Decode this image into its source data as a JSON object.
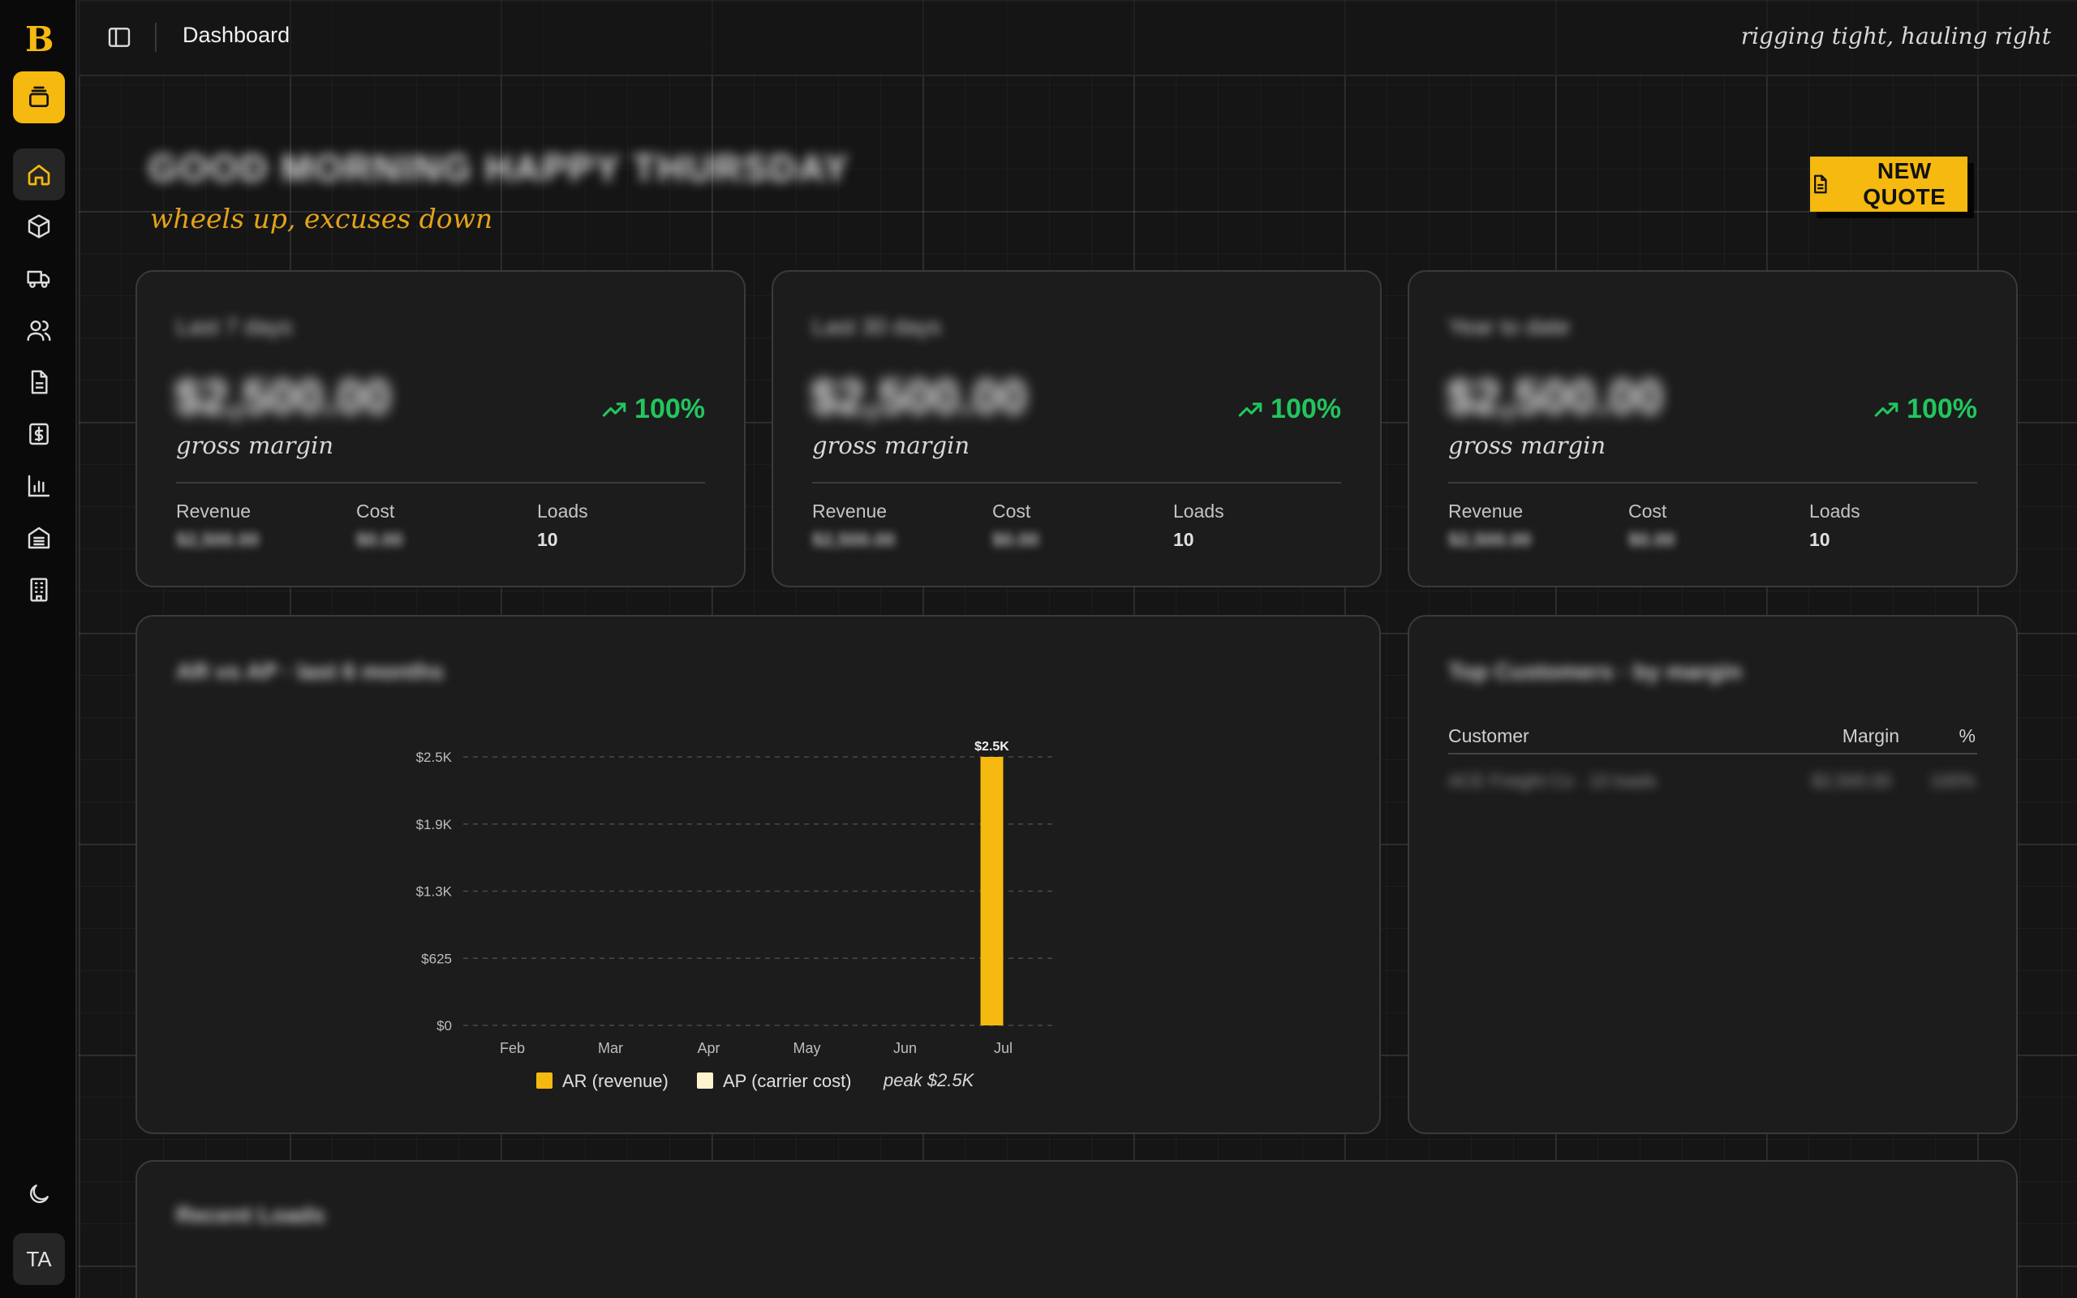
{
  "brand": {
    "logo_letter": "B",
    "accent": "#f5b90f"
  },
  "sidebar": {
    "items": [
      {
        "name": "queue",
        "icon": "stack-icon"
      },
      {
        "name": "home",
        "icon": "home-icon"
      },
      {
        "name": "loads",
        "icon": "package-icon"
      },
      {
        "name": "carriers",
        "icon": "truck-icon"
      },
      {
        "name": "customers",
        "icon": "users-icon"
      },
      {
        "name": "quotes",
        "icon": "document-icon"
      },
      {
        "name": "billing",
        "icon": "dollar-doc-icon"
      },
      {
        "name": "reports",
        "icon": "bar-chart-icon"
      },
      {
        "name": "ledger",
        "icon": "ledger-icon"
      },
      {
        "name": "companies",
        "icon": "building-icon"
      }
    ],
    "theme_icon": "moon-icon",
    "avatar_initials": "TA"
  },
  "topbar": {
    "breadcrumb": "Dashboard",
    "motto": "rigging tight, hauling right"
  },
  "header": {
    "greeting": "GOOD MORNING HAPPY THURSDAY",
    "subtitle": "wheels up, excuses down",
    "new_quote_label": "NEW QUOTE"
  },
  "kpis": [
    {
      "label": "Last 7 days",
      "amount": "$2,500.00",
      "trend": "100%",
      "caption": "gross margin",
      "revenue_label": "Revenue",
      "revenue": "$2,500.00",
      "cost_label": "Cost",
      "cost": "$0.00",
      "loads_label": "Loads",
      "loads": "10"
    },
    {
      "label": "Last 30 days",
      "amount": "$2,500.00",
      "trend": "100%",
      "caption": "gross margin",
      "revenue_label": "Revenue",
      "revenue": "$2,500.00",
      "cost_label": "Cost",
      "cost": "$0.00",
      "loads_label": "Loads",
      "loads": "10"
    },
    {
      "label": "Year to date",
      "amount": "$2,500.00",
      "trend": "100%",
      "caption": "gross margin",
      "revenue_label": "Revenue",
      "revenue": "$2,500.00",
      "cost_label": "Cost",
      "cost": "$0.00",
      "loads_label": "Loads",
      "loads": "10"
    }
  ],
  "trend_color": "#22c55e",
  "chart_title": "AR vs AP · last 6 months",
  "chart_data": {
    "type": "bar",
    "categories": [
      "Feb",
      "Mar",
      "Apr",
      "May",
      "Jun",
      "Jul"
    ],
    "series": [
      {
        "name": "AR (revenue)",
        "color": "#f5b90f",
        "values": [
          0,
          0,
          0,
          0,
          0,
          2500
        ]
      },
      {
        "name": "AP (carrier cost)",
        "color": "#fdf3cf",
        "values": [
          0,
          0,
          0,
          0,
          0,
          0
        ]
      }
    ],
    "y_ticks": [
      "$0",
      "$625",
      "$1.3K",
      "$1.9K",
      "$2.5K"
    ],
    "ylim": [
      0,
      2500
    ],
    "data_labels": [
      "",
      "",
      "",
      "",
      "",
      "$2.5K"
    ],
    "annotation": "peak $2.5K",
    "grid": true,
    "legend": "bottom"
  },
  "customers": {
    "title": "Top Customers · by margin",
    "columns": [
      "Customer",
      "Margin",
      "%"
    ],
    "rows": [
      {
        "customer": "ACE Freight Co · 10 loads",
        "margin": "$2,500.00",
        "pct": "100%"
      }
    ]
  },
  "recent": {
    "title": "Recent Loads"
  }
}
